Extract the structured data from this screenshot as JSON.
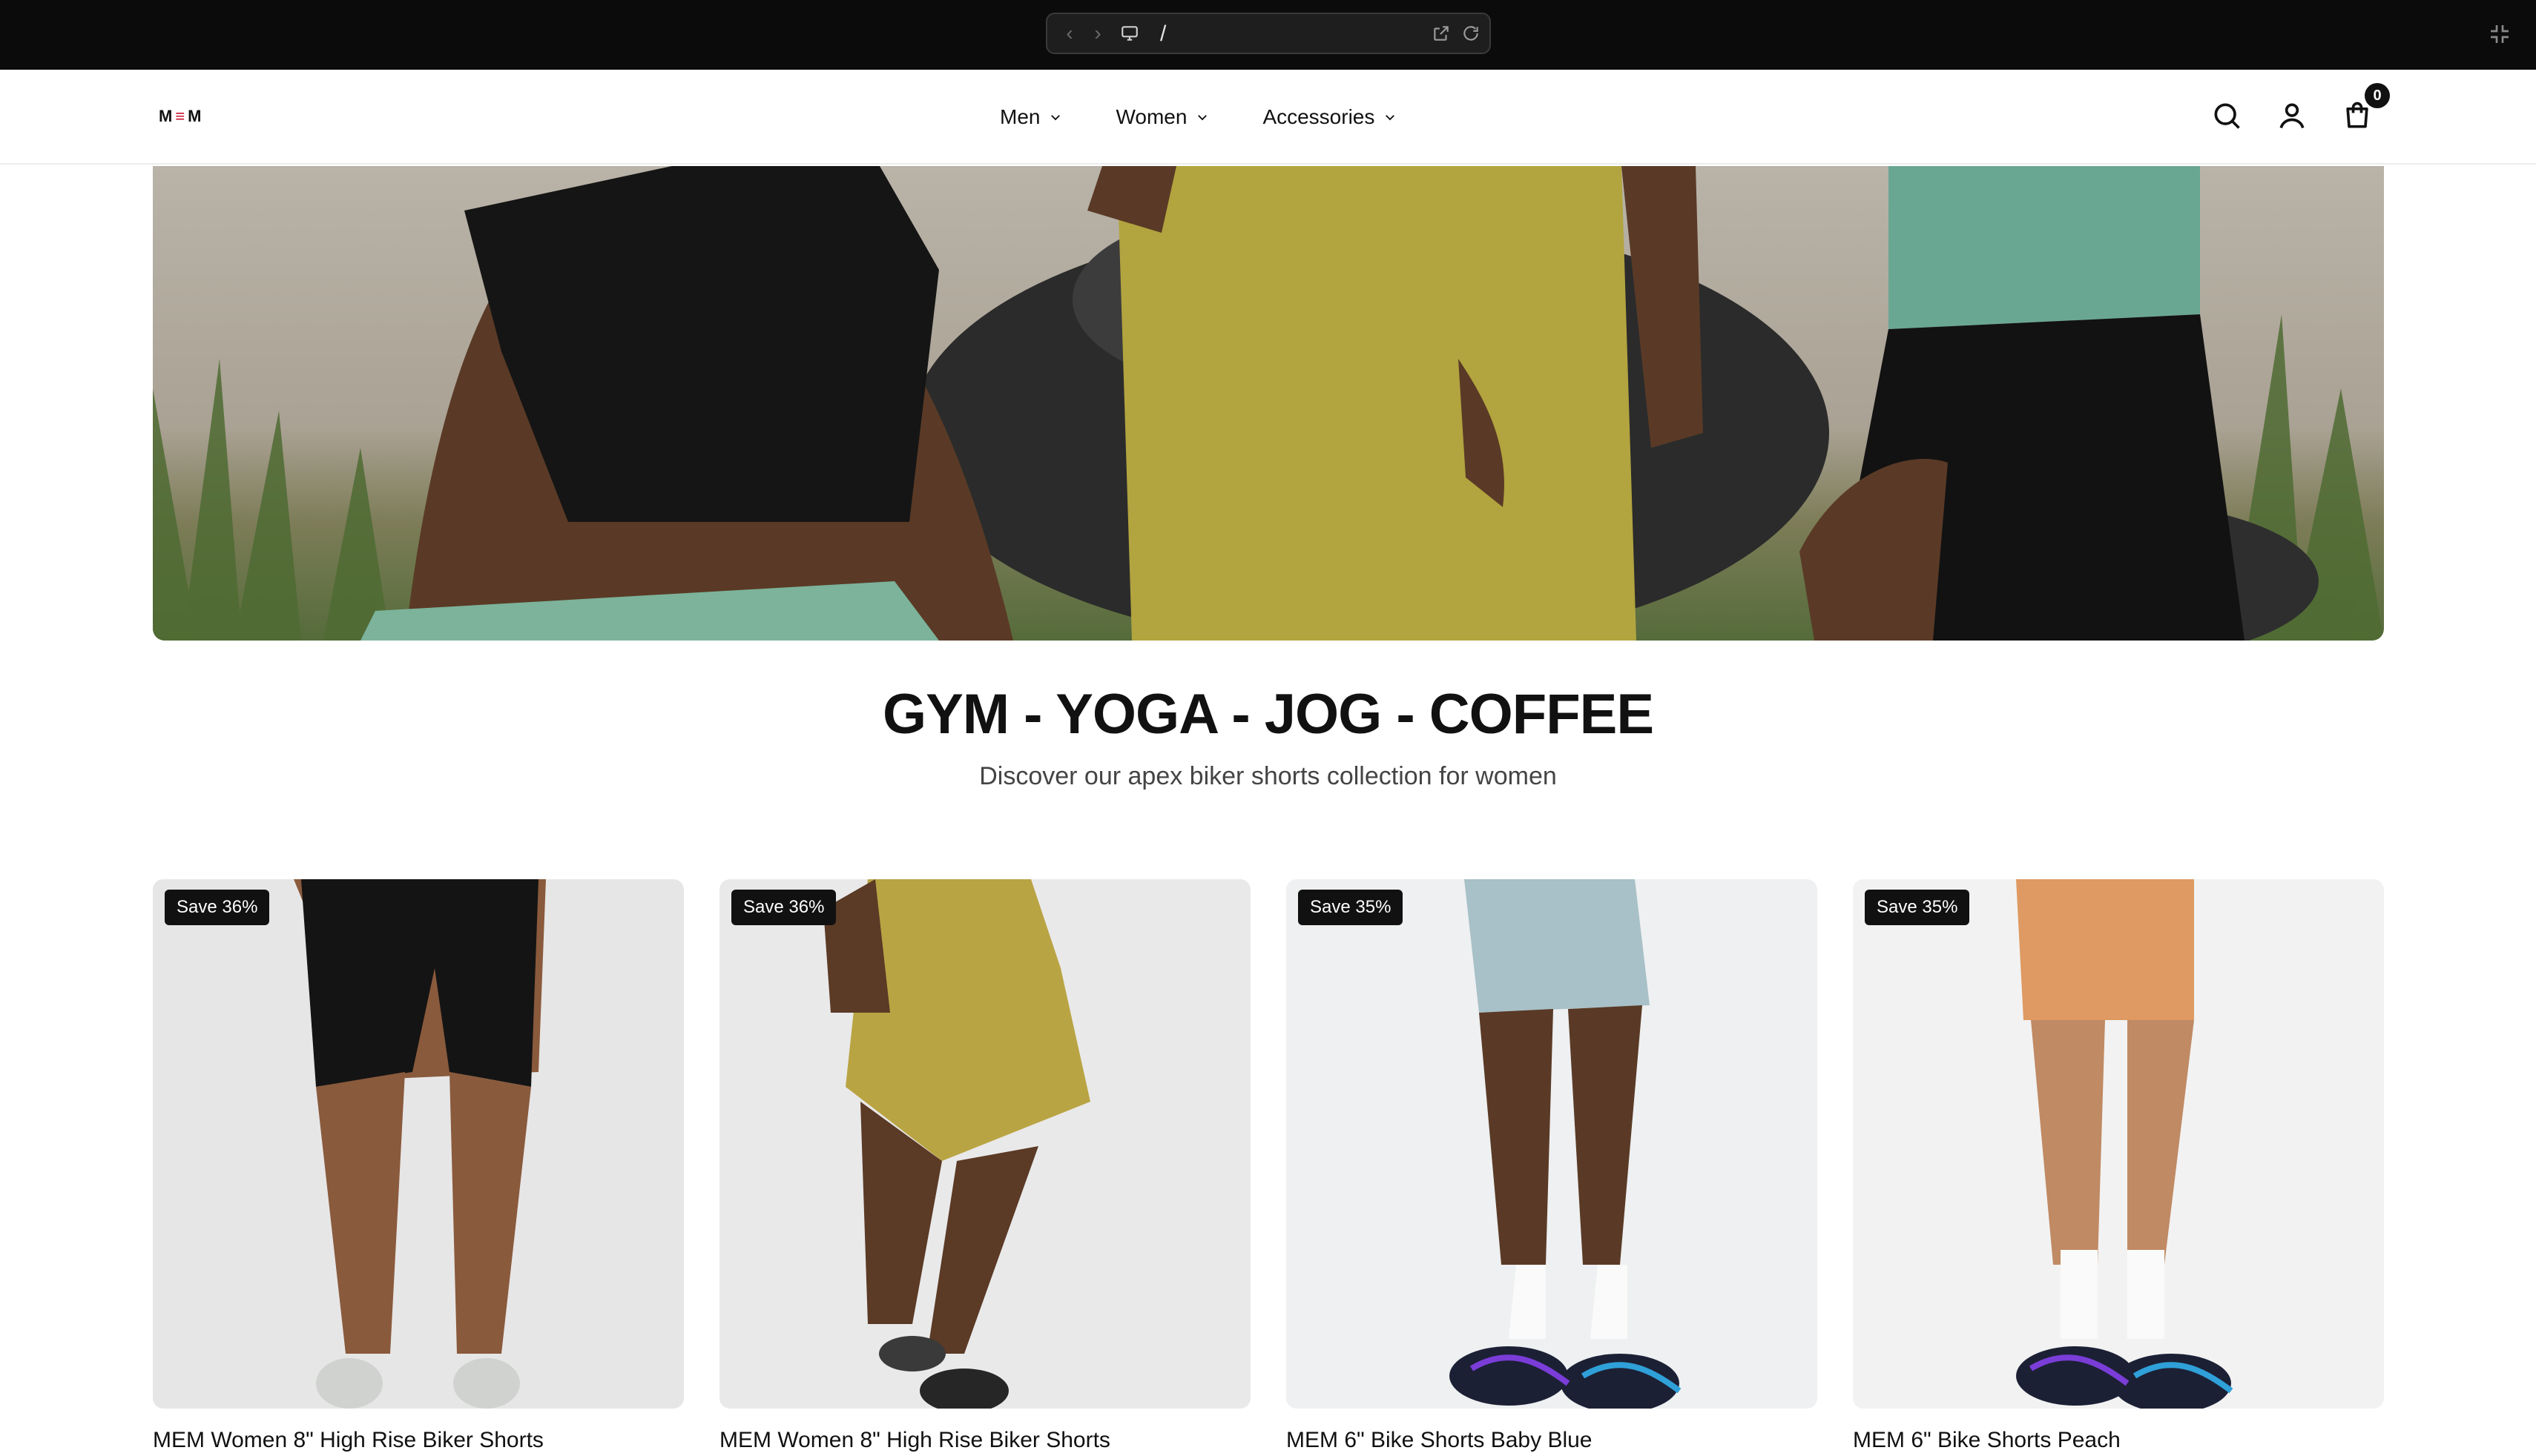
{
  "browser": {
    "url": "/",
    "icons": [
      "back-icon",
      "forward-icon",
      "monitor-icon",
      "open-external-icon",
      "reload-icon",
      "exit-fullscreen-icon"
    ]
  },
  "header": {
    "logo": {
      "left": "M",
      "mid": "≡",
      "right": "M"
    },
    "nav": [
      {
        "label": "Men"
      },
      {
        "label": "Women"
      },
      {
        "label": "Accessories"
      }
    ],
    "cart_count": "0"
  },
  "main": {
    "headline": "GYM - YOGA - JOG - COFFEE",
    "subheadline": "Discover our apex biker shorts collection for women"
  },
  "products": [
    {
      "badge": "Save 36%",
      "title": "MEM Women 8\" High Rise Biker Shorts",
      "color": "#141414"
    },
    {
      "badge": "Save 36%",
      "title": "MEM Women 8\" High Rise Biker Shorts",
      "color": "#b9a443"
    },
    {
      "badge": "Save 35%",
      "title": "MEM 6\" Bike Shorts Baby Blue",
      "color": "#a8c0c8"
    },
    {
      "badge": "Save 35%",
      "title": "MEM 6\" Bike Shorts Peach",
      "color": "#de9a62"
    }
  ],
  "colors": {
    "chrome_bg": "#0b0b0b",
    "badge_bg": "#111111",
    "brand_accent": "#c8102e"
  }
}
